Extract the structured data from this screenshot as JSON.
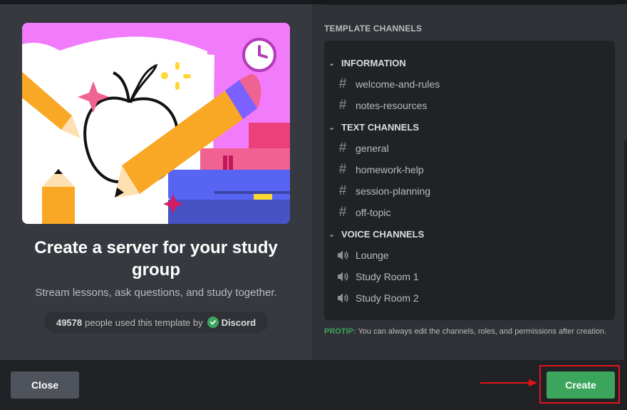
{
  "left_panel": {
    "title": "Create a server for your study group",
    "subtitle": "Stream lessons, ask questions, and study together.",
    "usage": {
      "count": "49578",
      "text": "people used this template by",
      "brand": "Discord"
    }
  },
  "right_panel": {
    "section_label": "TEMPLATE CHANNELS",
    "categories": [
      {
        "name": "INFORMATION",
        "channels": [
          {
            "name": "welcome-and-rules",
            "type": "text"
          },
          {
            "name": "notes-resources",
            "type": "text"
          }
        ]
      },
      {
        "name": "TEXT CHANNELS",
        "channels": [
          {
            "name": "general",
            "type": "text"
          },
          {
            "name": "homework-help",
            "type": "text"
          },
          {
            "name": "session-planning",
            "type": "text"
          },
          {
            "name": "off-topic",
            "type": "text"
          }
        ]
      },
      {
        "name": "VOICE CHANNELS",
        "channels": [
          {
            "name": "Lounge",
            "type": "voice"
          },
          {
            "name": "Study Room 1",
            "type": "voice"
          },
          {
            "name": "Study Room 2",
            "type": "voice"
          }
        ]
      }
    ],
    "protip": {
      "tag": "PROTIP:",
      "text": "You can always edit the channels, roles, and permissions after creation."
    }
  },
  "footer": {
    "close_label": "Close",
    "create_label": "Create"
  },
  "colors": {
    "accent_green": "#3ba55c",
    "highlight_red": "#e3131b",
    "illustration_bg": "#f27bfb"
  },
  "icons": {
    "text_channel": "hash-icon",
    "voice_channel": "speaker-icon",
    "category": "chevron-down-icon",
    "verified": "check-icon"
  }
}
